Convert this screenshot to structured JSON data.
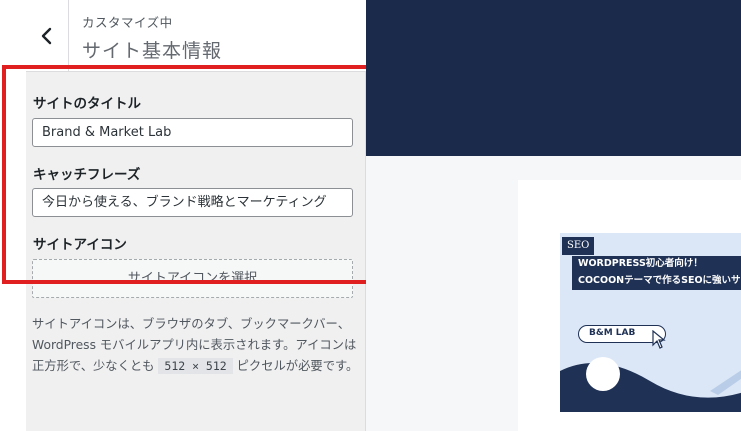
{
  "header": {
    "context_label": "カスタマイズ中",
    "title": "サイト基本情報"
  },
  "site_title": {
    "label": "サイトのタイトル",
    "value": "Brand & Market Lab"
  },
  "tagline": {
    "label": "キャッチフレーズ",
    "value": "今日から使える、ブランド戦略とマーケティング"
  },
  "site_icon": {
    "label": "サイトアイコン",
    "button_label": "サイトアイコンを選択",
    "description_before": "サイトアイコンは、ブラウザのタブ、ブックマークバー、WordPress モバイルアプリ内に表示されます。アイコンは正方形で、少なくとも ",
    "size_code": "512 × 512",
    "description_after": " ピクセルが必要です。"
  },
  "preview": {
    "thumbnail": {
      "tag": "SEO",
      "line1": "WORDPRESS初心者向け！",
      "line2": "COCOONテーマで作るSEOに強いサイト",
      "pill": "B&M LAB"
    }
  },
  "colors": {
    "preview_header": "#1b2a4a",
    "highlight": "#e02020",
    "banner": "#1f3155"
  }
}
